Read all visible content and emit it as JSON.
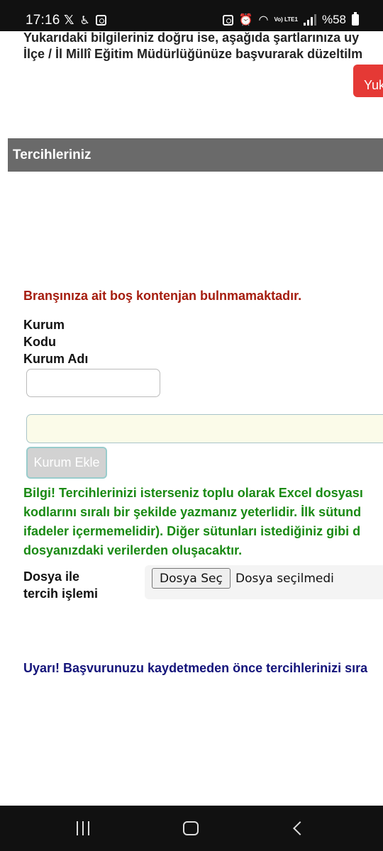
{
  "status_bar": {
    "time": "17:16",
    "battery": "%58",
    "icons": [
      "x-icon",
      "accessibility-icon",
      "square-app-icon",
      "lock-icon",
      "alarm-icon",
      "wifi-icon",
      "volte-icon",
      "signal-icon",
      "battery-icon"
    ],
    "lte_label": "Vo) LTE1"
  },
  "page": {
    "top_line_1": "Yukarıdaki bilgileriniz doğru ise, aşağıda şartlarınıza uy",
    "top_line_2": "İlçe / İl Millî Eğitim Müdürlüğünüze başvurarak düzeltilm",
    "red_button_label": "Yuka",
    "section_header": "Tercihleriniz",
    "error_message": "Branşınıza ait boş kontenjan bulnmamaktadır.",
    "kurum_kodu_line1": "Kurum",
    "kurum_kodu_line2": "Kodu",
    "kurum_adi_label": "Kurum Adı",
    "kurum_kodu_value": "",
    "kurum_adi_value": "",
    "add_button_label": "Kurum Ekle",
    "info_lines": [
      "Bilgi! Tercihlerinizi isterseniz toplu olarak Excel dosyası",
      "kodlarını sıralı bir şekilde yazmanız yeterlidir. İlk sütund",
      "ifadeler içermemelidir). Diğer sütunları istediğiniz gibi d",
      "dosyanızdaki verilerden oluşacaktır."
    ],
    "file_label_line1": "Dosya ile",
    "file_label_line2": "tercih işlemi",
    "file_button_label": "Dosya Seç",
    "file_status": "Dosya seçilmedi",
    "warning_message": "Uyarı! Başvurunuzu kaydetmeden önce tercihlerinizi sıra"
  },
  "colors": {
    "error": "#a51c0e",
    "info": "#1a8a14",
    "warning": "#14147a",
    "header_bg": "#6a6a6a",
    "red_button": "#e53935"
  }
}
